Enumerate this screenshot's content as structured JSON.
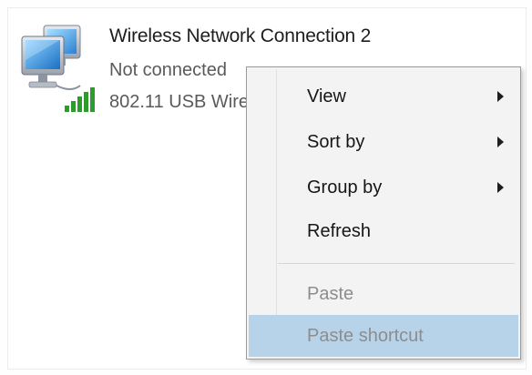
{
  "connection": {
    "name": "Wireless Network Connection 2",
    "status": "Not connected",
    "adapter": "802.11 USB Wire",
    "icon": "network-adapter-icon",
    "signal_icon": "wifi-signal-icon",
    "signal_color": "#2e9b2e"
  },
  "context_menu": {
    "items": [
      {
        "label": "View",
        "submenu": true,
        "enabled": true
      },
      {
        "label": "Sort by",
        "submenu": true,
        "enabled": true
      },
      {
        "label": "Group by",
        "submenu": true,
        "enabled": true
      },
      {
        "label": "Refresh",
        "submenu": false,
        "enabled": true
      },
      {
        "label": "Paste",
        "submenu": false,
        "enabled": false
      },
      {
        "label": "Paste shortcut",
        "submenu": false,
        "enabled": false,
        "highlighted": true
      }
    ],
    "highlight_color": "#b7d3ea"
  }
}
